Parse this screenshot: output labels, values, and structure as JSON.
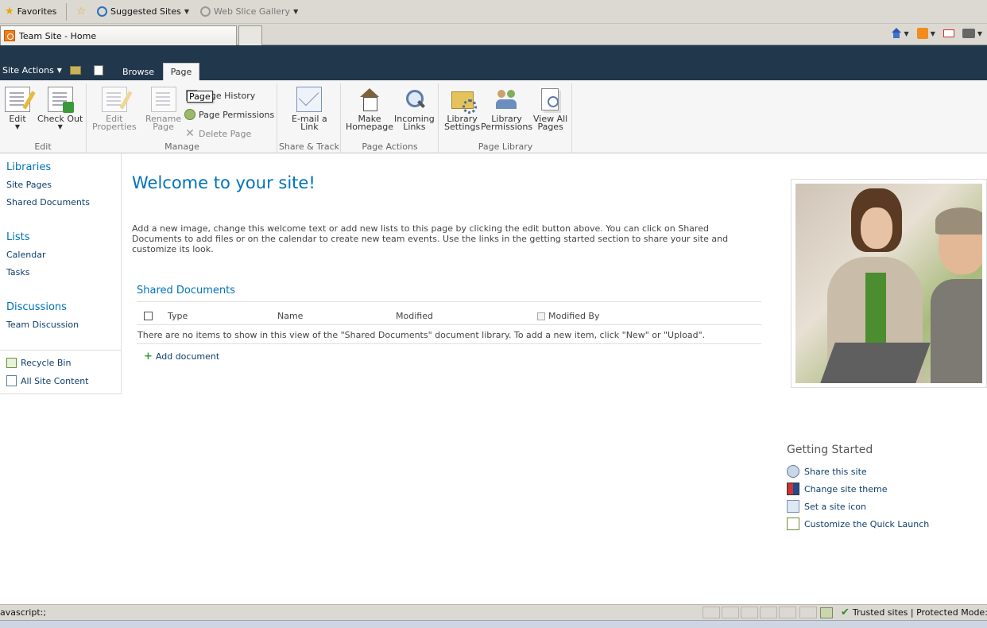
{
  "favorites_bar": {
    "favorites_label": "Favorites",
    "suggested_sites_label": "Suggested Sites",
    "web_slice_gallery_label": "Web Slice Gallery"
  },
  "browser_tab": {
    "title": "Team Site - Home"
  },
  "ribbon_header": {
    "site_actions_label": "Site Actions",
    "tabs": [
      "Browse",
      "Page"
    ],
    "active_tab": "Page"
  },
  "ribbon": {
    "groups": {
      "edit": "Edit",
      "manage": "Manage",
      "share_track": "Share & Track",
      "page_actions": "Page Actions",
      "page_library": "Page Library"
    },
    "buttons": {
      "edit": "Edit",
      "check_out": "Check Out",
      "edit_properties_1": "Edit",
      "edit_properties_2": "Properties",
      "rename_page_1": "Rename",
      "rename_page_2": "Page",
      "page_history": "Page History",
      "page_permissions": "Page Permissions",
      "delete_page": "Delete Page",
      "email_link_1": "E-mail a",
      "email_link_2": "Link",
      "make_homepage_1": "Make",
      "make_homepage_2": "Homepage",
      "incoming_links_1": "Incoming",
      "incoming_links_2": "Links",
      "library_settings_1": "Library",
      "library_settings_2": "Settings",
      "library_permissions_1": "Library",
      "library_permissions_2": "Permissions",
      "view_all_pages_1": "View All",
      "view_all_pages_2": "Pages"
    },
    "tooltip": "Page"
  },
  "left_nav": {
    "libraries_heading": "Libraries",
    "libraries": [
      "Site Pages",
      "Shared Documents"
    ],
    "lists_heading": "Lists",
    "lists": [
      "Calendar",
      "Tasks"
    ],
    "discussions_heading": "Discussions",
    "discussions": [
      "Team Discussion"
    ],
    "recycle_bin": "Recycle Bin",
    "all_site_content": "All Site Content"
  },
  "main": {
    "title": "Welcome to your site!",
    "intro": "Add a new image, change this welcome text or add new lists to this page by clicking the edit button above. You can click on Shared Documents to add files or on the calendar to create new team events. Use the links in the getting started section to share your site and customize its look.",
    "web_part_title": "Shared Documents",
    "columns": [
      "Type",
      "Name",
      "Modified",
      "Modified By"
    ],
    "empty_message": "There are no items to show in this view of the \"Shared Documents\" document library. To add a new item, click \"New\" or \"Upload\".",
    "add_document": "Add document"
  },
  "getting_started": {
    "title": "Getting Started",
    "items": [
      "Share this site",
      "Change site theme",
      "Set a site icon",
      "Customize the Quick Launch"
    ]
  },
  "status_bar": {
    "left_text": "avascript:;",
    "zone_text": "Trusted sites | Protected Mode: Of"
  }
}
